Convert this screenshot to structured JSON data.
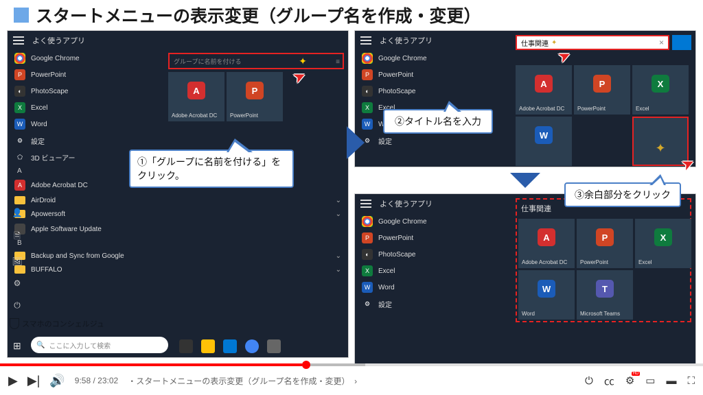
{
  "title": "スタートメニューの表示変更（グループ名を作成・変更）",
  "left": {
    "list_header": "よく使うアプリ",
    "apps": [
      {
        "label": "Google Chrome"
      },
      {
        "label": "PowerPoint"
      },
      {
        "label": "PhotoScape"
      },
      {
        "label": "Excel"
      },
      {
        "label": "Word"
      },
      {
        "label": "設定"
      },
      {
        "label": "3D ビューアー"
      }
    ],
    "letter_a": "A",
    "a_items": [
      {
        "label": "Adobe Acrobat DC"
      },
      {
        "label": "AirDroid"
      },
      {
        "label": "Apowersoft"
      },
      {
        "label": "Apple Software Update"
      }
    ],
    "letter_b": "B",
    "b_items": [
      {
        "label": "Backup and Sync from Google"
      },
      {
        "label": "BUFFALO"
      }
    ],
    "group_placeholder": "グループに名前を付ける",
    "tiles": [
      {
        "label": "Adobe Acrobat DC"
      },
      {
        "label": "PowerPoint"
      }
    ],
    "callout1": "①「グループに名前を付ける」をクリック。",
    "search_placeholder": "ここに入力して検索"
  },
  "right1": {
    "list_header": "よく使うアプリ",
    "apps": [
      {
        "label": "Google Chrome"
      },
      {
        "label": "PowerPoint"
      },
      {
        "label": "PhotoScape"
      },
      {
        "label": "Excel"
      },
      {
        "label": "Word"
      },
      {
        "label": "設定"
      }
    ],
    "input_value": "仕事関連",
    "tiles": [
      {
        "label": "Adobe Acrobat DC"
      },
      {
        "label": "PowerPoint"
      },
      {
        "label": "Excel"
      }
    ],
    "callout2": "②タイトル名を入力",
    "callout3": "③余白部分をクリック"
  },
  "right2": {
    "list_header": "よく使うアプリ",
    "apps": [
      {
        "label": "Google Chrome"
      },
      {
        "label": "PowerPoint"
      },
      {
        "label": "PhotoScape"
      },
      {
        "label": "Excel"
      },
      {
        "label": "Word"
      },
      {
        "label": "設定"
      }
    ],
    "group_name": "仕事関連",
    "tiles": [
      {
        "label": "Adobe Acrobat DC"
      },
      {
        "label": "PowerPoint"
      },
      {
        "label": "Excel"
      },
      {
        "label": "Word"
      },
      {
        "label": "Microsoft Teams"
      }
    ]
  },
  "player": {
    "current": "9:58",
    "total": "23:02",
    "chapter": "・スタートメニューの表示変更（グループ名を作成・変更）",
    "hd": "HD"
  },
  "watermark": "スマホのコンシェルジュ"
}
